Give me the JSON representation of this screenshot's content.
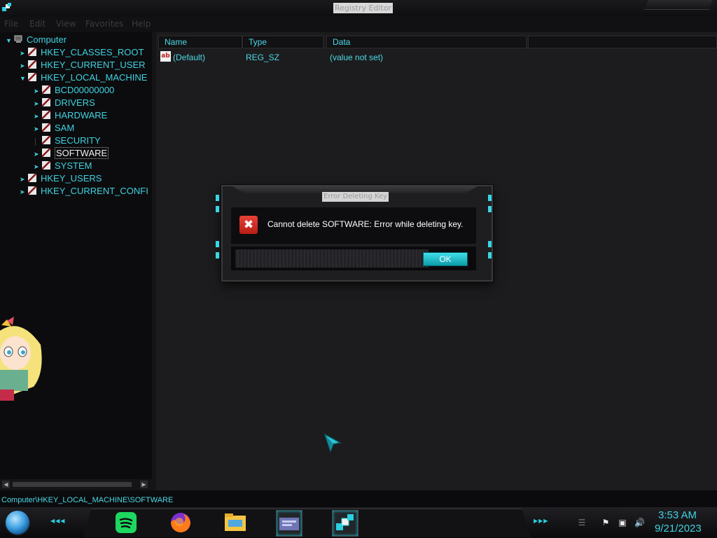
{
  "window": {
    "title": "Registry Editor"
  },
  "menu": [
    "File",
    "Edit",
    "View",
    "Favorites",
    "Help"
  ],
  "tree": {
    "root": "Computer",
    "hives": [
      {
        "label": "HKEY_CLASSES_ROOT"
      },
      {
        "label": "HKEY_CURRENT_USER"
      },
      {
        "label": "HKEY_LOCAL_MACHINE"
      },
      {
        "label": "HKEY_USERS"
      },
      {
        "label": "HKEY_CURRENT_CONFI"
      }
    ],
    "hklm_children": [
      {
        "label": "BCD00000000"
      },
      {
        "label": "DRIVERS"
      },
      {
        "label": "HARDWARE"
      },
      {
        "label": "SAM"
      },
      {
        "label": "SECURITY"
      },
      {
        "label": "SOFTWARE",
        "selected": true
      },
      {
        "label": "SYSTEM"
      }
    ]
  },
  "list": {
    "columns": [
      "Name",
      "Type",
      "Data"
    ],
    "rows": [
      {
        "name": "(Default)",
        "type": "REG_SZ",
        "data": "(value not set)",
        "icon": "string-value-icon"
      }
    ]
  },
  "status": {
    "path": "Computer\\HKEY_LOCAL_MACHINE\\SOFTWARE"
  },
  "dialog": {
    "title": "Error Deleting Key",
    "message": "Cannot delete SOFTWARE:  Error while deleting key.",
    "ok_label": "OK",
    "icon": "error-icon"
  },
  "taskbar": {
    "apps": [
      "spotify-icon",
      "firefox-icon",
      "file-explorer-icon",
      "control-panel-icon",
      "registry-editor-icon"
    ],
    "tray": [
      "action-center-flag-icon",
      "network-icon",
      "volume-icon"
    ],
    "time": "3:53 AM",
    "date": "9/21/2023"
  },
  "colors": {
    "accent": "#3fd2e0",
    "error": "#d32c22",
    "background": "#1c1c1e"
  }
}
